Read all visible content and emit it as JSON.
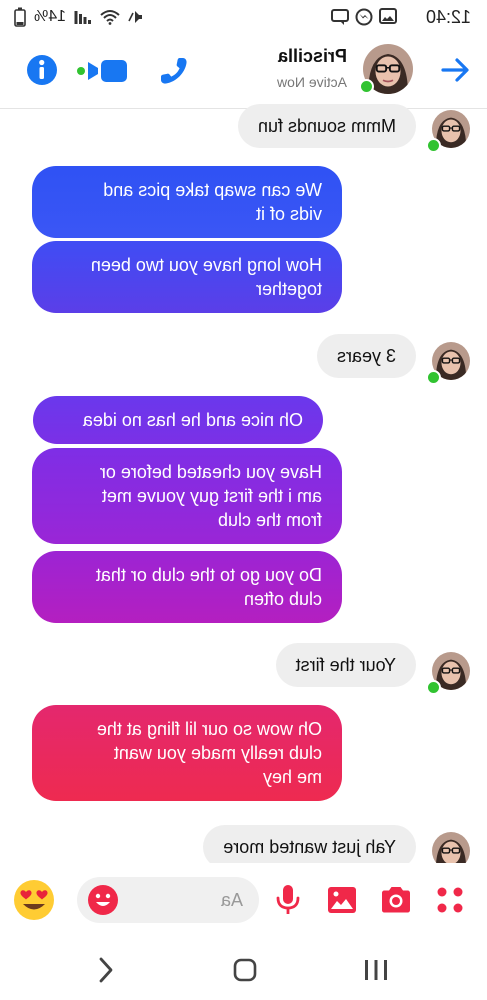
{
  "status_bar": {
    "time": "12:40",
    "battery": "14%",
    "icons": [
      "image-icon",
      "messenger-icon",
      "mute-icon",
      "wifi-icon",
      "signal-icon",
      "battery-icon"
    ]
  },
  "header": {
    "contact_name": "Priscilla",
    "contact_status": "Active Now",
    "icons": [
      "back-arrow-icon",
      "phone-icon",
      "video-icon",
      "info-icon"
    ]
  },
  "messages": [
    {
      "direction": "in",
      "text": "Mmm  sounds fun"
    },
    {
      "direction": "out",
      "lines": [
        "We can swap take pics and",
        "vids of it"
      ]
    },
    {
      "direction": "out",
      "lines": [
        "How long have you two been",
        "together"
      ]
    },
    {
      "direction": "in",
      "text": "3 years"
    },
    {
      "direction": "out",
      "lines": [
        "Oh nice and he has no idea"
      ]
    },
    {
      "direction": "out",
      "lines": [
        "Have you cheated before or",
        "am i the first guy youve met",
        "from the club"
      ]
    },
    {
      "direction": "out",
      "lines": [
        "Do you go to the club or that",
        "club often"
      ]
    },
    {
      "direction": "in",
      "text": "Your the first"
    },
    {
      "direction": "out",
      "lines": [
        "Oh wow so our lil fling at the",
        "club really made you want",
        "me hey"
      ]
    },
    {
      "direction": "in",
      "text": "Yah just wanted more"
    }
  ],
  "composer": {
    "placeholder": "Aa",
    "icons": [
      "more-dots-icon",
      "camera-icon",
      "gallery-icon",
      "microphone-icon",
      "smiley-icon",
      "heart-eyes-emoji-icon"
    ]
  },
  "colors": {
    "accent_blue": "#1877f2",
    "messenger_red": "#f02849",
    "bubble_in": "#eeeeee",
    "online_green": "#31c331"
  },
  "nav_bar": {
    "icons": [
      "recent-apps-icon",
      "home-icon",
      "back-chevron-icon"
    ]
  }
}
